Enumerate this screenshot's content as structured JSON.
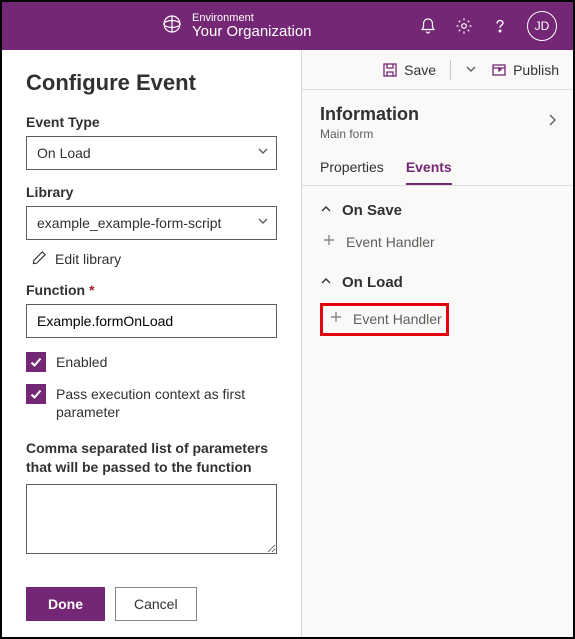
{
  "topbar": {
    "env_label": "Environment",
    "org_name": "Your Organization",
    "avatar_initials": "JD"
  },
  "left": {
    "title": "Configure Event",
    "event_type_label": "Event Type",
    "event_type_value": "On Load",
    "library_label": "Library",
    "library_value": "example_example-form-script",
    "edit_library": "Edit library",
    "function_label": "Function",
    "function_required": "*",
    "function_value": "Example.formOnLoad",
    "enabled_label": "Enabled",
    "pass_ctx_label": "Pass execution context as first parameter",
    "params_label": "Comma separated list of parameters that will be passed to the function",
    "params_value": "",
    "done": "Done",
    "cancel": "Cancel"
  },
  "cmdbar": {
    "save": "Save",
    "publish": "Publish"
  },
  "right": {
    "info_title": "Information",
    "info_sub": "Main form",
    "tab_properties": "Properties",
    "tab_events": "Events",
    "on_save": "On Save",
    "on_load": "On Load",
    "event_handler": "Event Handler"
  }
}
